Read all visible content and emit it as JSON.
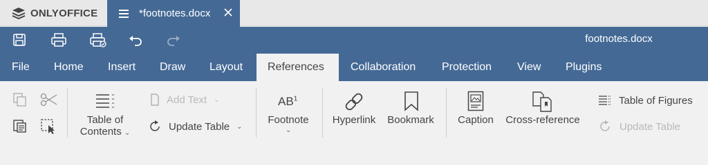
{
  "app": {
    "brand": "ONLYOFFICE"
  },
  "tab": {
    "title": "*footnotes.docx"
  },
  "header": {
    "doc_title": "footnotes.docx"
  },
  "menu": {
    "file": "File",
    "home": "Home",
    "insert": "Insert",
    "draw": "Draw",
    "layout": "Layout",
    "references": "References",
    "collaboration": "Collaboration",
    "protection": "Protection",
    "view": "View",
    "plugins": "Plugins"
  },
  "toolbar": {
    "toc_line1": "Table of",
    "toc_line2": "Contents",
    "add_text": "Add Text",
    "update_table": "Update Table",
    "footnote": "Footnote",
    "footnote_icon_text": "AB",
    "footnote_icon_sup": "1",
    "hyperlink": "Hyperlink",
    "bookmark": "Bookmark",
    "caption": "Caption",
    "cross_reference": "Cross-reference",
    "table_of_figures": "Table of Figures",
    "update_table_figures": "Update Table"
  },
  "colors": {
    "header": "#446995",
    "toolbar": "#f1f1f1",
    "text": "#444444",
    "disabled": "#b9b9b9"
  }
}
